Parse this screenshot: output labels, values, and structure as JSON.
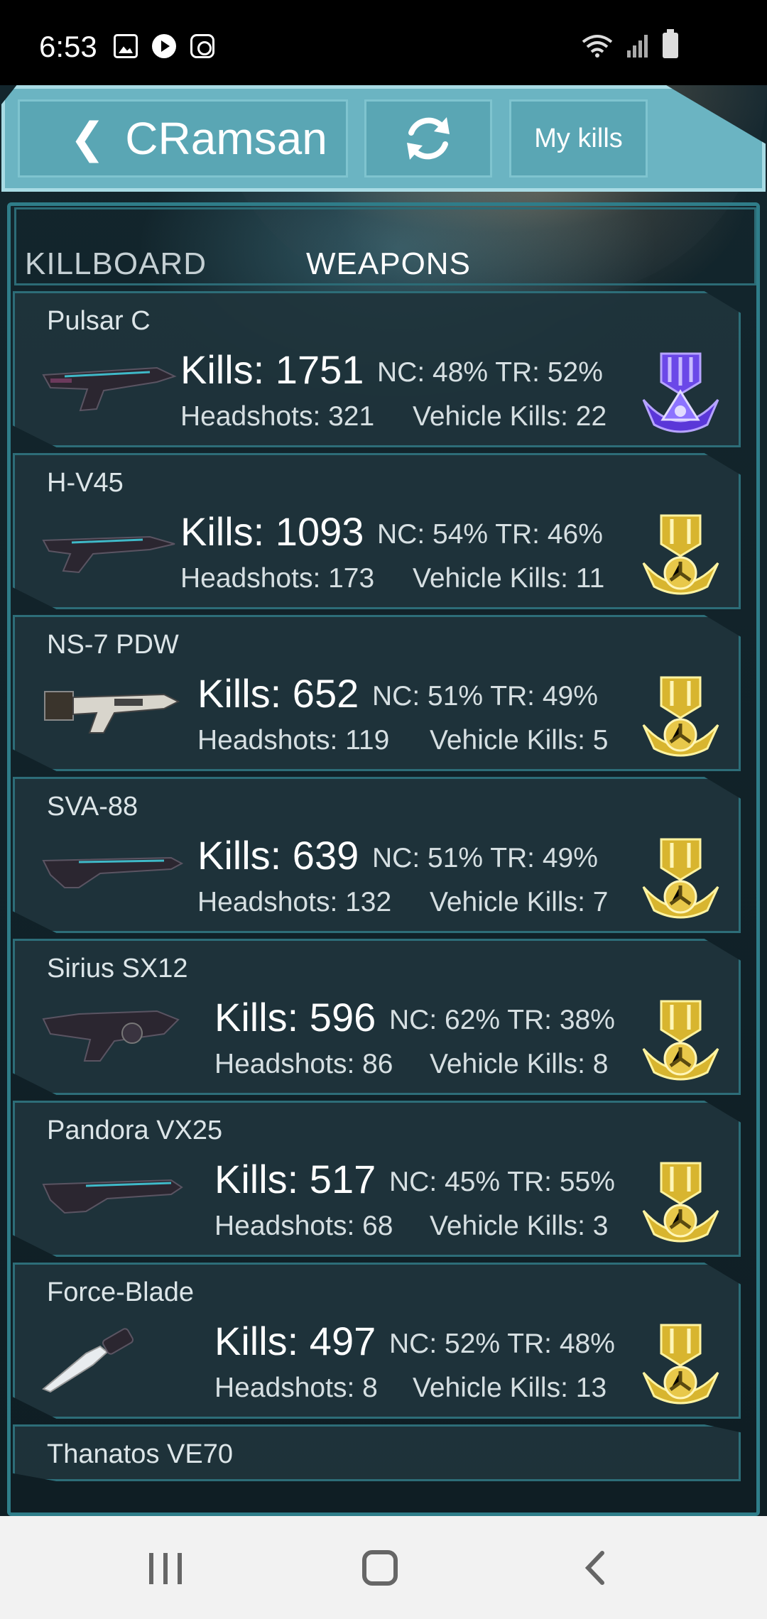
{
  "status_bar": {
    "time": "6:53",
    "left_icons": [
      "gallery-icon",
      "play-icon",
      "instagram-icon"
    ],
    "right_icons": [
      "wifi-icon",
      "signal-icon",
      "battery-icon"
    ]
  },
  "header": {
    "back_chevron": "❮",
    "title": "CRamsan",
    "refresh_icon": "refresh-icon",
    "my_kills_label": "My kills"
  },
  "tabs": [
    {
      "label": "KILLBOARD",
      "active": false
    },
    {
      "label": "WEAPONS",
      "active": true
    }
  ],
  "weapons": [
    {
      "name": "Pulsar C",
      "kills": "Kills: 1751",
      "faction": "NC: 48% TR: 52%",
      "headshots": "Headshots: 321",
      "vehicle_kills": "Vehicle Kills: 22",
      "medal": "purple"
    },
    {
      "name": "H-V45",
      "kills": "Kills: 1093",
      "faction": "NC: 54% TR: 46%",
      "headshots": "Headshots: 173",
      "vehicle_kills": "Vehicle Kills: 11",
      "medal": "gold"
    },
    {
      "name": "NS-7 PDW",
      "kills": "Kills: 652",
      "faction": "NC: 51% TR: 49%",
      "headshots": "Headshots: 119",
      "vehicle_kills": "Vehicle Kills: 5",
      "medal": "gold"
    },
    {
      "name": "SVA-88",
      "kills": "Kills: 639",
      "faction": "NC: 51% TR: 49%",
      "headshots": "Headshots: 132",
      "vehicle_kills": "Vehicle Kills: 7",
      "medal": "gold"
    },
    {
      "name": "Sirius SX12",
      "kills": "Kills: 596",
      "faction": "NC: 62% TR: 38%",
      "headshots": "Headshots: 86",
      "vehicle_kills": "Vehicle Kills: 8",
      "medal": "gold"
    },
    {
      "name": "Pandora VX25",
      "kills": "Kills: 517",
      "faction": "NC: 45% TR: 55%",
      "headshots": "Headshots: 68",
      "vehicle_kills": "Vehicle Kills: 3",
      "medal": "gold"
    },
    {
      "name": "Force-Blade",
      "kills": "Kills: 497",
      "faction": "NC: 52% TR: 48%",
      "headshots": "Headshots: 8",
      "vehicle_kills": "Vehicle Kills: 13",
      "medal": "gold"
    },
    {
      "name": "Thanatos VE70"
    }
  ],
  "colors": {
    "accent": "#6bb4c2",
    "gold_medal": "#e6c84a",
    "purple_medal": "#7a5cf0",
    "card_bg": "#1f343c",
    "border": "#2d6d78"
  },
  "nav_bar": {
    "recent_icon": "recent-apps-icon",
    "home_icon": "home-icon",
    "back_icon": "back-icon"
  }
}
